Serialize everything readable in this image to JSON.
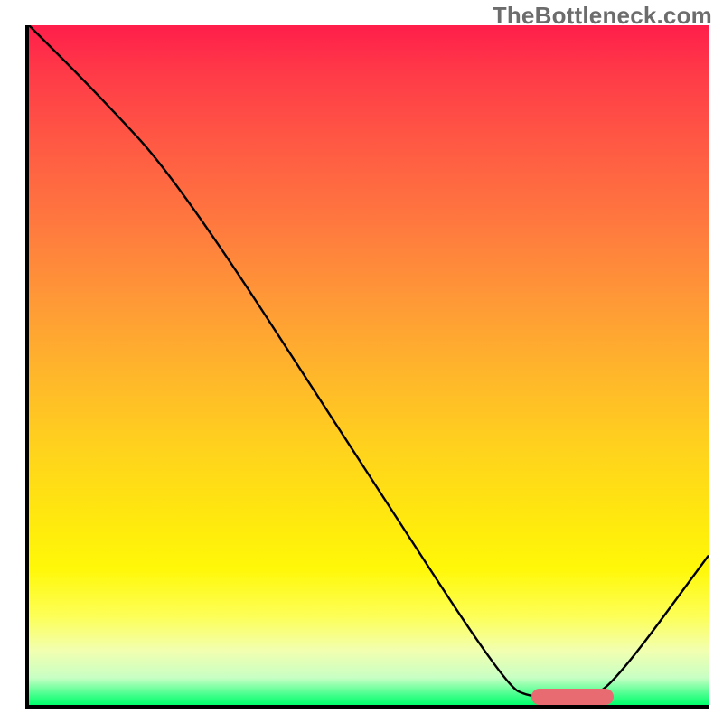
{
  "watermark": "TheBottleneck.com",
  "chart_data": {
    "type": "line",
    "title": "",
    "xlabel": "",
    "ylabel": "",
    "xlim": [
      0,
      100
    ],
    "ylim": [
      0,
      100
    ],
    "grid": false,
    "legend": false,
    "background_gradient": {
      "direction": "vertical",
      "stops": [
        {
          "pos": 0.0,
          "color": "#ff1e4a"
        },
        {
          "pos": 0.3,
          "color": "#ff7b3e"
        },
        {
          "pos": 0.63,
          "color": "#ffd41c"
        },
        {
          "pos": 0.87,
          "color": "#fdff58"
        },
        {
          "pos": 1.0,
          "color": "#00ff6a"
        }
      ]
    },
    "series": [
      {
        "name": "bottleneck-curve",
        "color": "#000000",
        "x": [
          0,
          10,
          22,
          48,
          70,
          74,
          82,
          86,
          100
        ],
        "y": [
          100,
          90,
          77,
          37,
          3,
          1,
          1,
          3,
          22
        ]
      }
    ],
    "markers": [
      {
        "name": "optimal-range",
        "color": "#e86b72",
        "shape": "rounded-bar",
        "x_start": 74,
        "x_end": 86,
        "y": 1.2
      }
    ]
  }
}
